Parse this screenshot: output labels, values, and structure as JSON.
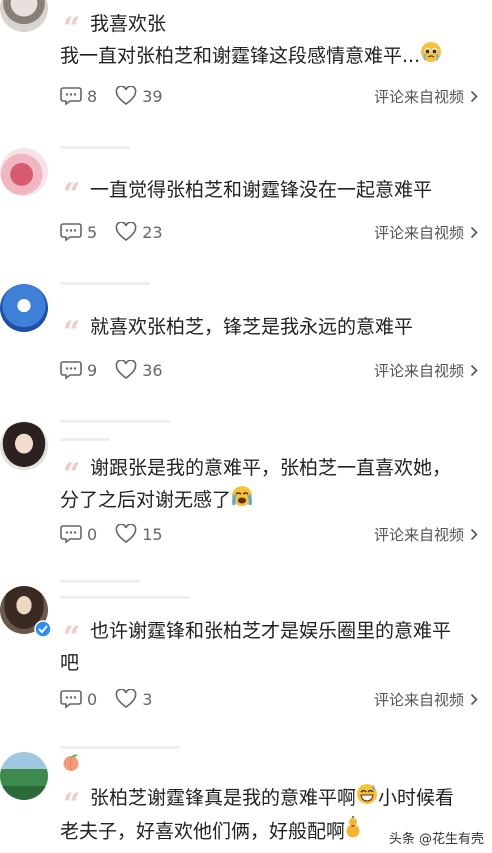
{
  "comments": [
    {
      "lines": [
        "我喜欢张",
        "我一直对张柏芝和谢霆锋这段感情意难平..."
      ],
      "reply_count": "8",
      "like_count": "39",
      "source": "评论来自视频"
    },
    {
      "lines": [
        "一直觉得张柏芝和谢霆锋没在一起意难平"
      ],
      "reply_count": "5",
      "like_count": "23",
      "source": "评论来自视频"
    },
    {
      "lines": [
        "就喜欢张柏芝，锋芝是我永远的意难平"
      ],
      "reply_count": "9",
      "like_count": "36",
      "source": "评论来自视频"
    },
    {
      "lines": [
        "谢跟张是我的意难平，张柏芝一直喜欢她，",
        "分了之后对谢无感了"
      ],
      "reply_count": "0",
      "like_count": "15",
      "source": "评论来自视频"
    },
    {
      "lines": [
        "也许谢霆锋和张柏芝才是娱乐圈里的意难平",
        "吧"
      ],
      "reply_count": "0",
      "like_count": "3",
      "source": "评论来自视频"
    },
    {
      "lines": [
        "张柏芝谢霆锋真是我的意难平啊",
        "小时候看",
        "老夫子，好喜欢他们俩，好般配啊"
      ]
    }
  ],
  "quote_mark": "“",
  "watermark": "头条 @花生有壳",
  "icons": [
    "comment-icon",
    "heart-icon",
    "chevron-right-icon",
    "verified-badge-icon",
    "peach-emoji-icon",
    "pleading-face-emoji",
    "crying-face-emoji",
    "grinning-sweat-emoji",
    "gourd-emoji"
  ],
  "colors": {
    "quote": "#f4c9c9",
    "text": "#222222",
    "meta": "#666666",
    "verified": "#2f8cf0"
  }
}
